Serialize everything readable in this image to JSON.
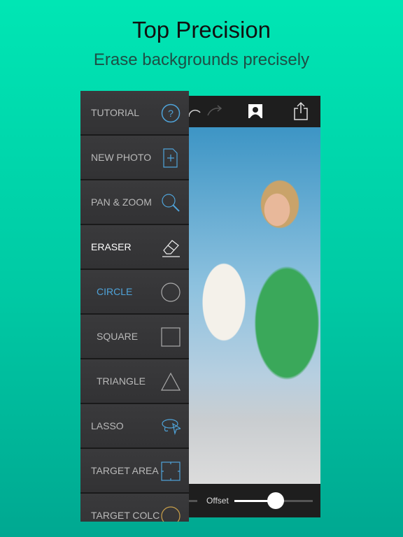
{
  "header": {
    "title": "Top Precision",
    "subtitle": "Erase backgrounds precisely"
  },
  "menu": {
    "items": [
      {
        "label": "TUTORIAL",
        "icon": "help-circle-icon"
      },
      {
        "label": "NEW PHOTO",
        "icon": "new-document-icon"
      },
      {
        "label": "PAN & ZOOM",
        "icon": "magnifier-icon"
      },
      {
        "label": "ERASER",
        "icon": "eraser-icon"
      },
      {
        "label": "CIRCLE",
        "icon": "circle-icon"
      },
      {
        "label": "SQUARE",
        "icon": "square-icon"
      },
      {
        "label": "TRIANGLE",
        "icon": "triangle-icon"
      },
      {
        "label": "LASSO",
        "icon": "lasso-icon"
      },
      {
        "label": "TARGET AREA",
        "icon": "target-area-icon"
      },
      {
        "label": "TARGET COLC",
        "icon": "color-wheel-icon"
      }
    ]
  },
  "toolbar": {
    "icons": [
      "undo-icon",
      "redo-icon",
      "portrait-icon",
      "share-icon"
    ]
  },
  "bottom": {
    "offset_label": "Offset",
    "offset_value": 0.53
  },
  "colors": {
    "accent": "#4fa3d9",
    "background": "#00d9aa"
  }
}
